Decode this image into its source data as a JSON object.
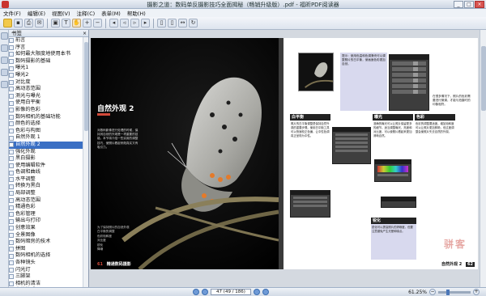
{
  "window": {
    "title": "摄影之道：数码单反摄影技巧全面揭秘（畅销升级版）.pdf - 福昕PDF阅读器"
  },
  "menu": [
    "文件(F)",
    "编辑(E)",
    "视图(V)",
    "注释(C)",
    "表单(M)",
    "帮助(H)"
  ],
  "sidebar": {
    "header": "书签",
    "items": [
      "前言",
      "序言",
      "如何最大限度地使用本书",
      "数码摄影的基础",
      "曝光1",
      "曝光2",
      "对比度",
      "高动态范围",
      "测光与曝光",
      "使用白平衡",
      "影像的色彩",
      "数码相机的基础功能",
      "颜色的选择",
      "色彩与构图",
      "自然外观 1",
      "自然外观 2",
      "强化外观",
      "黑白摄影",
      "使用编辑软件",
      "色调和曲线",
      "水平调整",
      "转换为黑白",
      "局部调整",
      "高动态范围",
      "精通色彩",
      "色彩管理",
      "输出与打印",
      "创意效果",
      "全景图像",
      "数码暗房的技术",
      "拼图",
      "数码相机的选择",
      "各种镜头",
      "闪光灯",
      "三脚架",
      "相机的清洁",
      "文件格式",
      "术语表",
      "索引"
    ],
    "selected_index": 15
  },
  "left_page": {
    "title": "自然外观 2",
    "intro": "对数码影像进行处理的时候，保持其自然的外观是一项重要的技能。本节将介绍一些实用的调整技巧，使照片看起来既真实又有吸引力。",
    "list": [
      "为了保持照片的自然外观",
      "白平衡的调整",
      "色彩饱和度",
      "对比度",
      "锐化",
      "降噪"
    ],
    "footer_num": "61",
    "footer_text": "精通数码摄影"
  },
  "right_page": {
    "top_notes": "提示：使用色温和色调滑块可以调整照片的白平衡，使画面色彩更加自然。",
    "side_text": "在很多情况下，照片的色彩需要进行微调，才能与拍摄时的印象相符。",
    "col1_title": "白平衡",
    "col1_text": "照片的白平衡调整是保持自然外观的重要步骤。使用白平衡工具可以快速校正色偏，让中性色调真正呈现为中性。",
    "col2_title": "曝光",
    "col2_text": "准确的曝光可以让照片保留更多的细节。适当调整曝光、亮度和对比度，可以使照片看起来更加清晰自然。",
    "col3_title": "色彩",
    "col3_text": "色彩的调整要适度。增加饱和度可以让照片更加鲜艳，但过度调整会使照片失去自然的外观。",
    "bottom_title": "锐化",
    "bottom_text": "锐化可以提高照片的清晰度，但要注意避免产生光晕和噪点。",
    "footer_text": "自然外观 2",
    "footer_num": "62",
    "watermark": "骈客"
  },
  "statusbar": {
    "page_field": "47 (49 / 186)",
    "zoom": "61.25%"
  }
}
